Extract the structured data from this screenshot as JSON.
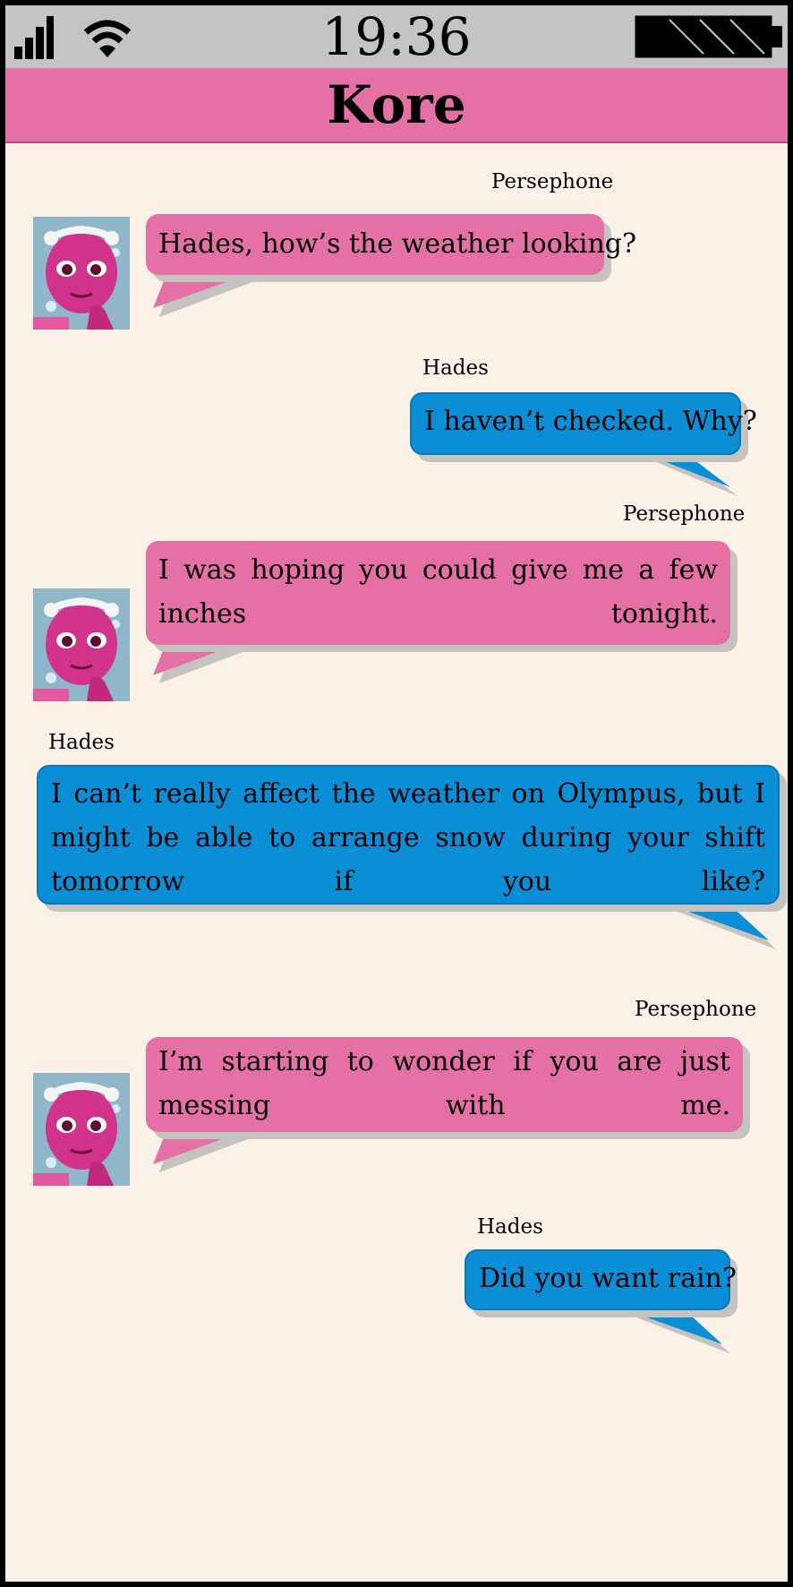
{
  "status_bar": {
    "time": "19:36",
    "signal_icon": "signal-bars-icon",
    "wifi_icon": "wifi-icon",
    "battery_icon": "battery-full-icon"
  },
  "chat": {
    "title": "Kore",
    "messages": [
      {
        "sender": "Persephone",
        "text": "Hades, how’s the weather looking?"
      },
      {
        "sender": "Hades",
        "text": "I haven’t checked. Why?"
      },
      {
        "sender": "Persephone",
        "text": "I was hoping you could give me a few inches tonight."
      },
      {
        "sender": "Hades",
        "text": "I can’t really affect the weather on Olympus, but I might be able to arrange snow during your shift tomorrow if you like?"
      },
      {
        "sender": "Persephone",
        "text": "I’m starting to wonder if you are just messing with me."
      },
      {
        "sender": "Hades",
        "text": "Did you want rain?"
      }
    ]
  },
  "colors": {
    "persephone_bubble": "#e570a6",
    "hades_bubble": "#0a8fd6",
    "background": "#fbf1e6",
    "status_bar": "#c4c4c4"
  }
}
